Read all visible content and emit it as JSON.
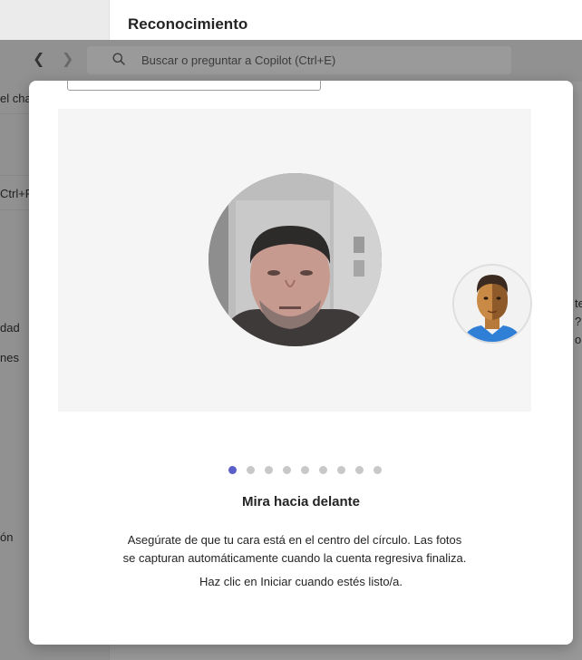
{
  "app": {
    "title": "Reconocimiento",
    "search_placeholder": "Buscar o preguntar a Copilot (Ctrl+E)",
    "left_peek": [
      "el chat",
      "Ctrl+F",
      "dad",
      "nes",
      "ón"
    ],
    "right_peek": [
      "te",
      "?",
      "o"
    ]
  },
  "dialog": {
    "step_title": "Mira hacia delante",
    "description_line1": "Asegúrate de que tu cara está en el centro del círculo. Las fotos",
    "description_line2": "se capturan automáticamente cuando la cuenta regresiva finaliza.",
    "hint": "Haz clic en Iniciar cuando estés listo/a.",
    "progress": {
      "total_steps": 9,
      "current_step": 1
    }
  },
  "colors": {
    "accent": "#5b5fc7",
    "dot_inactive": "#c8c8c8"
  }
}
